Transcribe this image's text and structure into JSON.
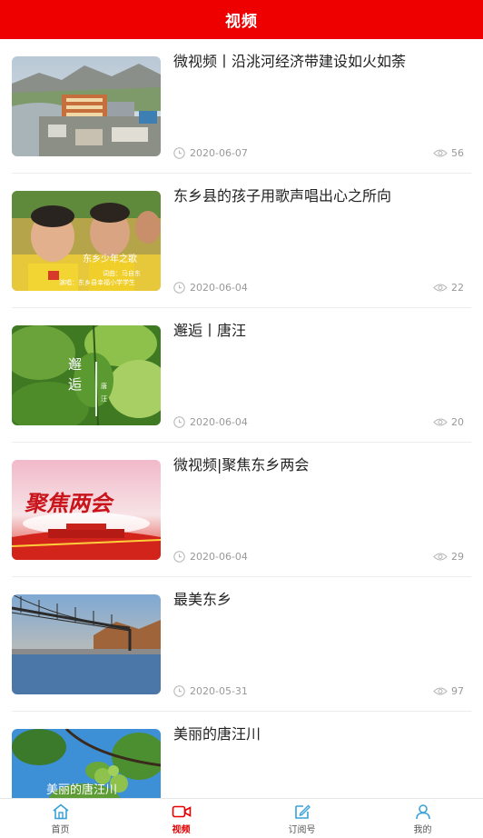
{
  "header": {
    "title": "视频"
  },
  "colors": {
    "brand": "#ee0000",
    "tab_icon": "#3aa0d8",
    "active_tab": "#e60000"
  },
  "videos": [
    {
      "title": "微视频丨沿洮河经济带建设如火如荼",
      "date": "2020-06-07",
      "views": "56",
      "thumb_icon": "city-river-thumbnail",
      "overlay": []
    },
    {
      "title": "东乡县的孩子用歌声唱出心之所向",
      "date": "2020-06-04",
      "views": "22",
      "thumb_icon": "children-singing-thumbnail",
      "overlay": [
        "东乡少年之歌",
        "词曲：马自东",
        "演唱：东乡县幸福小学学生"
      ]
    },
    {
      "title": "邂逅丨唐汪",
      "date": "2020-06-04",
      "views": "20",
      "thumb_icon": "green-leaves-thumbnail",
      "overlay": [
        "邂",
        "逅",
        "唐",
        "汪"
      ]
    },
    {
      "title": "微视频|聚焦东乡两会",
      "date": "2020-06-04",
      "views": "29",
      "thumb_icon": "two-sessions-thumbnail",
      "overlay": [
        "聚焦两会"
      ]
    },
    {
      "title": "最美东乡",
      "date": "2020-05-31",
      "views": "97",
      "thumb_icon": "bridge-lake-thumbnail",
      "overlay": []
    },
    {
      "title": "美丽的唐汪川",
      "date": "",
      "views": "",
      "thumb_icon": "apricot-tree-thumbnail",
      "overlay": [
        "美丽的唐汪川"
      ]
    }
  ],
  "tabbar": {
    "items": [
      {
        "label": "首页",
        "icon": "home-icon",
        "active": false
      },
      {
        "label": "视频",
        "icon": "video-camera-icon",
        "active": true
      },
      {
        "label": "订阅号",
        "icon": "edit-subscribe-icon",
        "active": false
      },
      {
        "label": "我的",
        "icon": "user-icon",
        "active": false
      }
    ]
  }
}
